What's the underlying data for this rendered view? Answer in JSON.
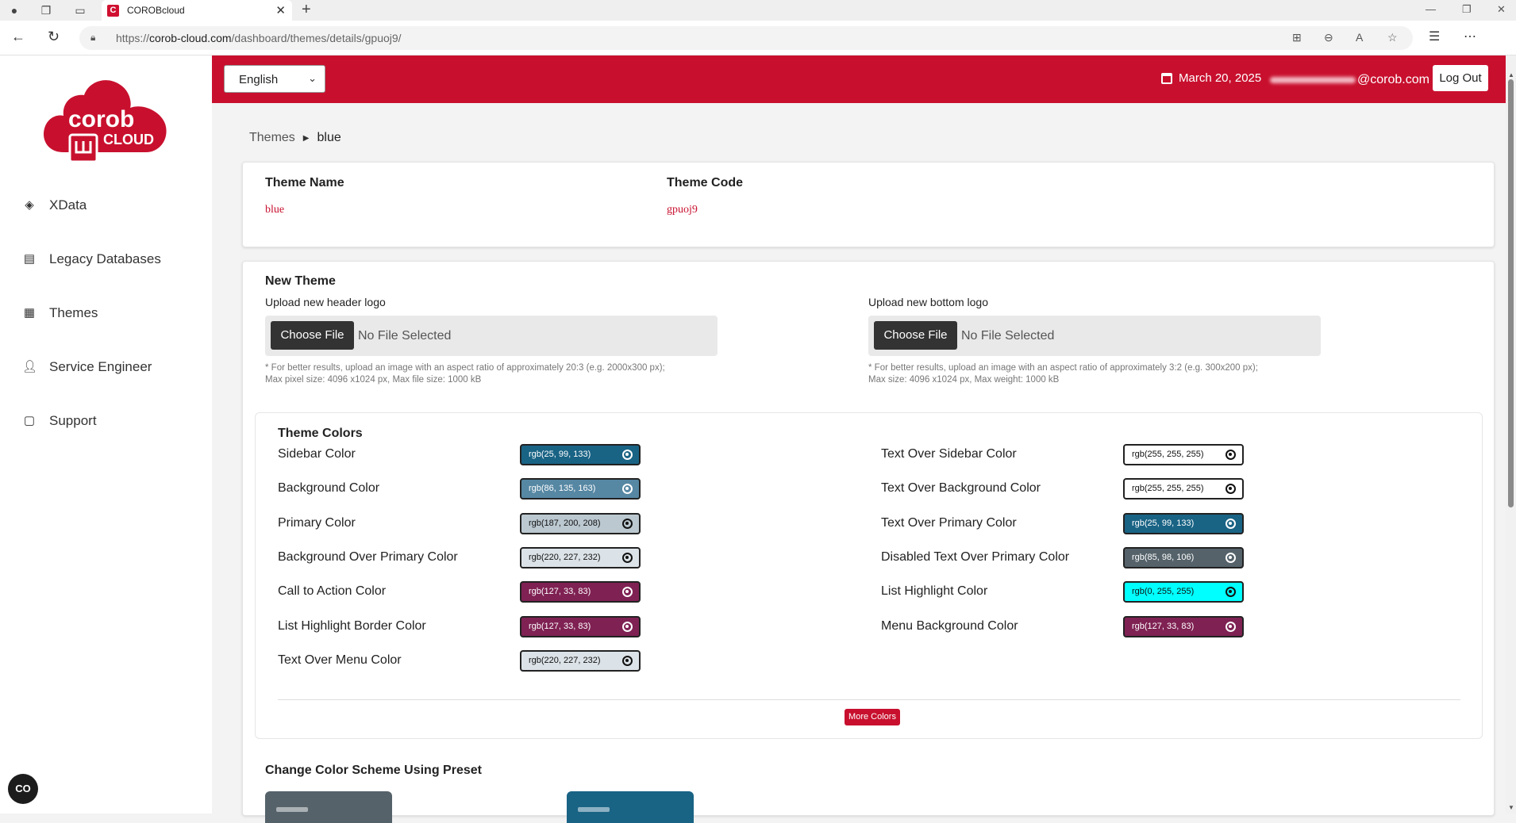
{
  "browser": {
    "tab_title": "COROBcloud",
    "tab_favicon_letter": "C",
    "url_prefix": "https://",
    "url_domain": "corob-cloud.com",
    "url_path": "/dashboard/themes/details/gpuoj9/"
  },
  "sidebar": {
    "items": [
      {
        "label": "XData",
        "icon": "layers-icon"
      },
      {
        "label": "Legacy Databases",
        "icon": "list-icon"
      },
      {
        "label": "Themes",
        "icon": "grid-icon"
      },
      {
        "label": "Service Engineer",
        "icon": "person-wrench-icon"
      },
      {
        "label": "Support",
        "icon": "chat-icon"
      }
    ],
    "bottom_button": "CO"
  },
  "header": {
    "language": "English",
    "date": "March 20, 2025",
    "email_domain": "@corob.com",
    "logout_label": "Log Out"
  },
  "breadcrumb": {
    "parent": "Themes",
    "current": "blue"
  },
  "theme_info": {
    "name_label": "Theme Name",
    "name_value": "blue",
    "code_label": "Theme Code",
    "code_value": "gpuoj9"
  },
  "new_theme": {
    "title": "New Theme",
    "header_logo_label": "Upload new header logo",
    "bottom_logo_label": "Upload new bottom logo",
    "choose_file_label": "Choose File",
    "no_file_text": "No File Selected",
    "header_hint_1": "* For better results, upload an image with an aspect ratio of approximately 20:3 (e.g. 2000x300 px);",
    "header_hint_2": "Max pixel size: 4096 x1024 px, Max file size: 1000 kB",
    "bottom_hint_1": "* For better results, upload an image with an aspect ratio of approximately 3:2 (e.g. 300x200 px);",
    "bottom_hint_2": "Max size: 4096 x1024 px, Max weight: 1000 kB"
  },
  "theme_colors": {
    "title": "Theme Colors",
    "left": [
      {
        "label": "Sidebar Color",
        "value": "rgb(25, 99, 133)",
        "bg": "#196385",
        "fg": "#ffffff"
      },
      {
        "label": "Background Color",
        "value": "rgb(86, 135, 163)",
        "bg": "#5687a3",
        "fg": "#ffffff"
      },
      {
        "label": "Primary Color",
        "value": "rgb(187, 200, 208)",
        "bg": "#bbc8d0",
        "fg": "#111111"
      },
      {
        "label": "Background Over Primary Color",
        "value": "rgb(220, 227, 232)",
        "bg": "#dce3e8",
        "fg": "#111111"
      },
      {
        "label": "Call to Action Color",
        "value": "rgb(127, 33, 83)",
        "bg": "#7f2153",
        "fg": "#ffffff"
      },
      {
        "label": "List Highlight Border Color",
        "value": "rgb(127, 33, 83)",
        "bg": "#7f2153",
        "fg": "#ffffff"
      },
      {
        "label": "Text Over Menu Color",
        "value": "rgb(220, 227, 232)",
        "bg": "#dce3e8",
        "fg": "#111111"
      }
    ],
    "right": [
      {
        "label": "Text Over Sidebar Color",
        "value": "rgb(255, 255, 255)",
        "bg": "#ffffff",
        "fg": "#111111"
      },
      {
        "label": "Text Over Background Color",
        "value": "rgb(255, 255, 255)",
        "bg": "#ffffff",
        "fg": "#111111"
      },
      {
        "label": "Text Over Primary Color",
        "value": "rgb(25, 99, 133)",
        "bg": "#196385",
        "fg": "#ffffff"
      },
      {
        "label": "Disabled Text Over Primary Color",
        "value": "rgb(85, 98, 106)",
        "bg": "#55626a",
        "fg": "#ffffff"
      },
      {
        "label": "List Highlight Color",
        "value": "rgb(0, 255, 255)",
        "bg": "#00ffff",
        "fg": "#111111"
      },
      {
        "label": "Menu Background Color",
        "value": "rgb(127, 33, 83)",
        "bg": "#7f2153",
        "fg": "#ffffff"
      }
    ],
    "more_label": "More Colors"
  },
  "preset": {
    "title": "Change Color Scheme Using Preset",
    "swatches": [
      {
        "color": "#55626a"
      },
      {
        "color": "#196385"
      }
    ]
  },
  "colors": {
    "brand_red": "#c8102e"
  }
}
